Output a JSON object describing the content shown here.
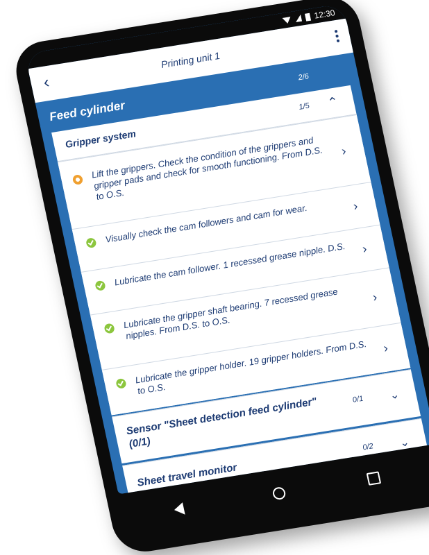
{
  "status_bar": {
    "time": "12:30"
  },
  "app_bar": {
    "title": "Printing unit 1",
    "back_icon": "chevron-left-icon",
    "menu_icon": "more-vert-icon"
  },
  "section": {
    "title": "Feed cylinder",
    "count": "2/6"
  },
  "group": {
    "title": "Gripper system",
    "count": "1/5",
    "expanded": true,
    "tasks": [
      {
        "text": "Lift the grippers. Check the condition of the grippers and gripper pads and check for smooth functioning. From D.S. to O.S.",
        "status": "open"
      },
      {
        "text": "Visually check the cam followers and cam for wear.",
        "status": "done"
      },
      {
        "text": "Lubricate the cam follower. 1 recessed grease nipple. D.S.",
        "status": "done"
      },
      {
        "text": "Lubricate the gripper shaft bearing. 7 recessed grease nipples. From D.S. to O.S.",
        "status": "done"
      },
      {
        "text": "Lubricate the gripper holder. 19 gripper holders. From D.S. to O.S.",
        "status": "done"
      }
    ]
  },
  "collapsed_groups": [
    {
      "title": "Sensor \"Sheet detection feed cylinder\" (0/1)",
      "count": "0/1"
    },
    {
      "title": "Sheet travel monitor",
      "count": "0/2"
    }
  ],
  "colors": {
    "primary": "#2a6fb3",
    "text": "#1d3b73",
    "done": "#8cc63e",
    "open": "#f0a030"
  }
}
